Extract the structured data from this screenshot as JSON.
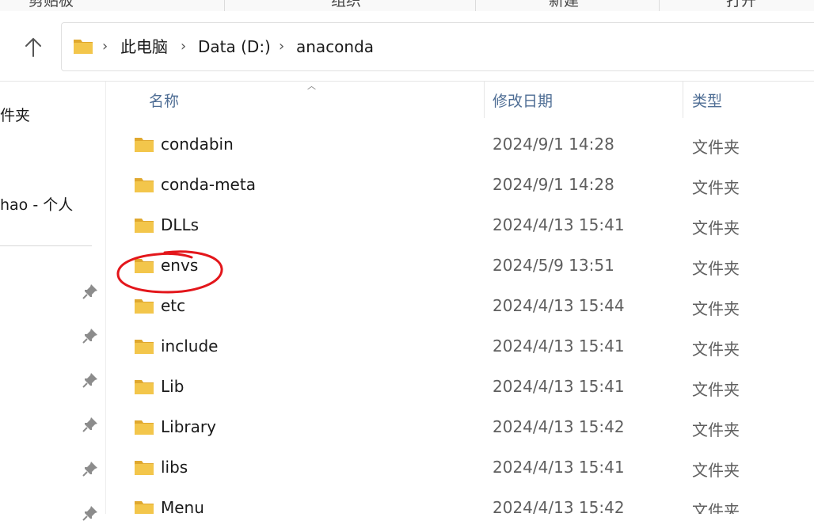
{
  "ribbon": {
    "groups": [
      "剪贴板",
      "组织",
      "新建",
      "打开"
    ]
  },
  "breadcrumb": [
    "此电脑",
    "Data (D:)",
    "anaconda"
  ],
  "nav_pane": {
    "items": [
      "件夹",
      "hao - 个人"
    ]
  },
  "columns": {
    "name": "名称",
    "modified": "修改日期",
    "type": "类型"
  },
  "files": [
    {
      "name": "condabin",
      "modified": "2024/9/1 14:28",
      "type": "文件夹"
    },
    {
      "name": "conda-meta",
      "modified": "2024/9/1 14:28",
      "type": "文件夹"
    },
    {
      "name": "DLLs",
      "modified": "2024/4/13 15:41",
      "type": "文件夹"
    },
    {
      "name": "envs",
      "modified": "2024/5/9 13:51",
      "type": "文件夹"
    },
    {
      "name": "etc",
      "modified": "2024/4/13 15:44",
      "type": "文件夹"
    },
    {
      "name": "include",
      "modified": "2024/4/13 15:41",
      "type": "文件夹"
    },
    {
      "name": "Lib",
      "modified": "2024/4/13 15:41",
      "type": "文件夹"
    },
    {
      "name": "Library",
      "modified": "2024/4/13 15:42",
      "type": "文件夹"
    },
    {
      "name": "libs",
      "modified": "2024/4/13 15:41",
      "type": "文件夹"
    },
    {
      "name": "Menu",
      "modified": "2024/4/13 15:42",
      "type": "文件夹"
    }
  ],
  "colors": {
    "folder": "#f3c64b",
    "folder_dark": "#e0a82e",
    "header_text": "#4f6e95",
    "annotation": "#e3161b"
  },
  "icons": [
    "up-arrow-icon",
    "folder-icon",
    "chevron-right-icon",
    "pin-icon",
    "sort-up-icon"
  ]
}
